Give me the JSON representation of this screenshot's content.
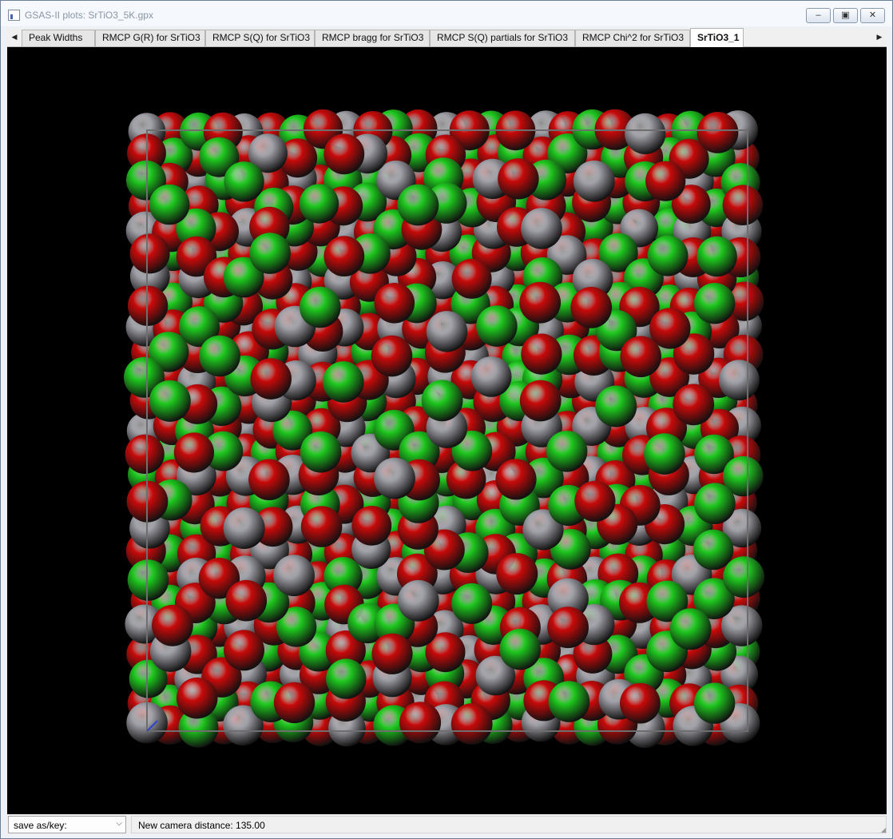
{
  "window": {
    "title": "GSAS-II plots: SrTiO3_5K.gpx",
    "controls": {
      "minimize_icon": "minimize-icon",
      "maximize_icon": "maximize-icon",
      "close_icon": "close-icon"
    }
  },
  "tabs": {
    "items": [
      {
        "label": "Peak Widths",
        "active": false
      },
      {
        "label": "RMCP G(R) for SrTiO3",
        "active": false
      },
      {
        "label": "RMCP S(Q) for SrTiO3",
        "active": false
      },
      {
        "label": "RMCP bragg for SrTiO3",
        "active": false
      },
      {
        "label": "RMCP S(Q) partials for SrTiO3",
        "active": false
      },
      {
        "label": "RMCP Chi^2 for SrTiO3",
        "active": false
      },
      {
        "label": "SrTiO3_1",
        "active": true
      }
    ],
    "scroll_left_icon": "triangle-left-icon",
    "scroll_right_icon": "triangle-right-icon"
  },
  "plot": {
    "background": "#000000",
    "atom_colors": {
      "Sr": "#1ec81e",
      "Ti": "#a0a0a8",
      "O": "#c80a0a"
    },
    "unit_cell_color": "#6e6e6e"
  },
  "statusbar": {
    "save_select_value": "save as/key:",
    "message": "New camera distance: 135.00"
  }
}
